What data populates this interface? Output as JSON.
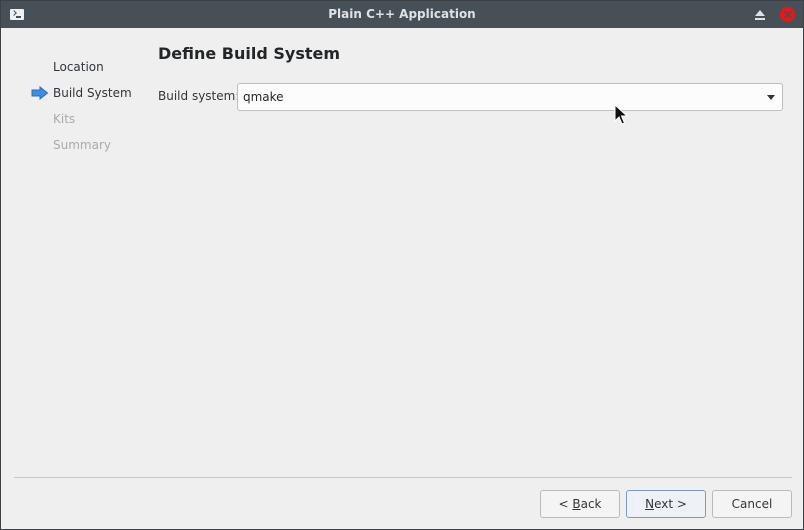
{
  "window": {
    "title": "Plain C++ Application"
  },
  "titlebar": {
    "icons": [
      "terminal-icon",
      "keep-above-icon",
      "close-icon"
    ],
    "close_color": "#ed1515"
  },
  "nav": {
    "items": [
      {
        "label": "Location",
        "state": "done"
      },
      {
        "label": "Build System",
        "state": "current"
      },
      {
        "label": "Kits",
        "state": "pending"
      },
      {
        "label": "Summary",
        "state": "pending"
      }
    ],
    "current_icon": "arrow-right-icon",
    "accent": "#3b8ee0"
  },
  "page": {
    "title": "Define Build System",
    "build_system_label": "Build system:",
    "build_system_value": "qmake"
  },
  "buttons": {
    "back": {
      "prefix": "< ",
      "mnemonic": "B",
      "rest": "ack"
    },
    "next": {
      "mnemonic": "N",
      "rest": "ext >"
    },
    "cancel": "Cancel"
  }
}
